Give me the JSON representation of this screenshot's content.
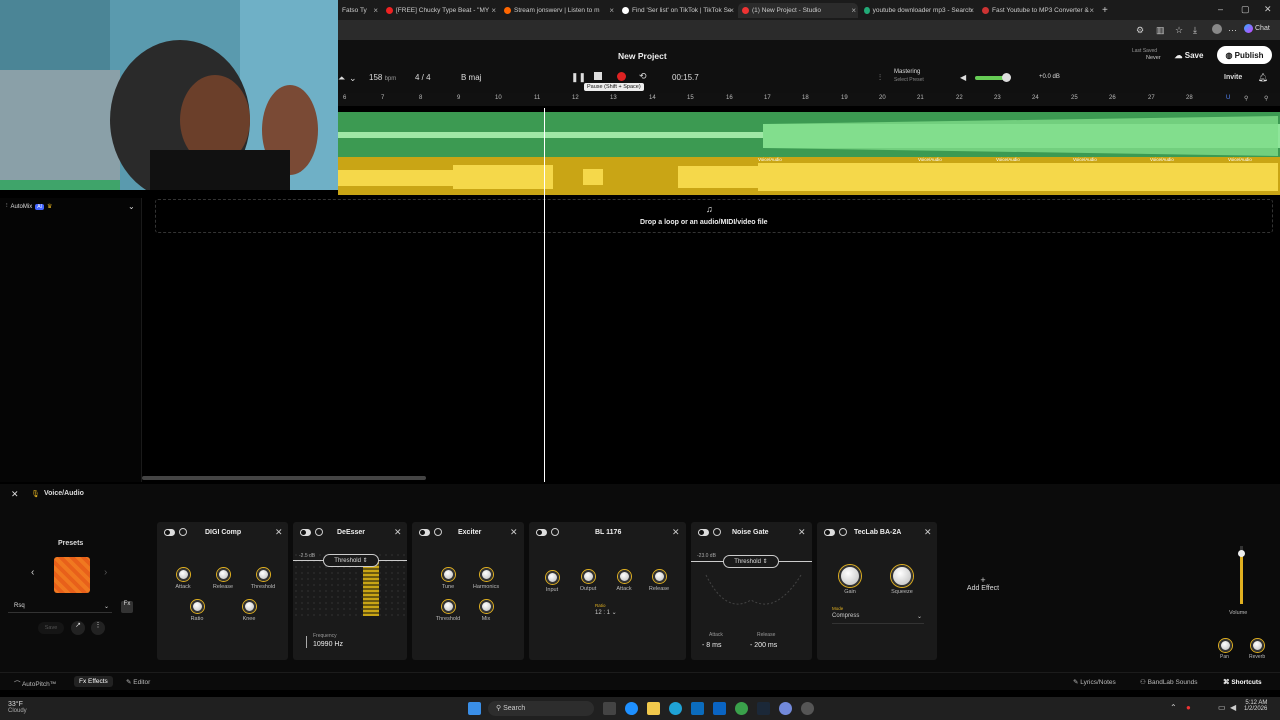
{
  "browser": {
    "tabs": [
      {
        "label": "Fatso Ty",
        "active": false
      },
      {
        "label": "[FREE] Chucky Type Beat - \"MY",
        "active": false
      },
      {
        "label": "Stream jonswerv | Listen to m",
        "active": false
      },
      {
        "label": "Find 'Ser list' on TikTok | TikTok Se",
        "active": false
      },
      {
        "label": "(1) New Project - Studio",
        "active": true
      },
      {
        "label": "youtube downloader mp3 - Search",
        "active": false
      },
      {
        "label": "Fast Youtube to MP3 Converter &",
        "active": false
      }
    ],
    "new_tab": "+",
    "chat_label": "Chat"
  },
  "header": {
    "project_title": "New Project",
    "bpm_value": "158",
    "bpm_unit": "bpm",
    "time_signature": "4 / 4",
    "key": "B maj",
    "time_display": "00:15.7",
    "tooltip": "Pause (Shift + Space)",
    "mastering_label": "Mastering",
    "mastering_sub": "Select Preset",
    "volume_db": "+0.0 dB",
    "last_saved_label": "Last Saved",
    "last_saved_value": "Never",
    "save_label": "Save",
    "publish_label": "Publish",
    "invite_label": "Invite"
  },
  "ruler": {
    "ticks": [
      "6",
      "7",
      "8",
      "9",
      "10",
      "11",
      "12",
      "13",
      "14",
      "15",
      "16",
      "17",
      "18",
      "19",
      "20",
      "21",
      "22",
      "23",
      "24",
      "25",
      "26",
      "27",
      "28"
    ]
  },
  "tracks": {
    "clip_label": "Voice/Audio",
    "drop_text": "Drop a loop or an audio/MIDI/video file",
    "automix_label": "AutoMix",
    "automix_badge": "AI"
  },
  "fx": {
    "track_name": "Voice/Audio",
    "presets_label": "Presets",
    "preset_name": "Rsq",
    "save_label": "Save",
    "add_effect_label": "Add Effect",
    "add_effect_plus": "+",
    "volume_label": "Volume",
    "pan_label": "Pan",
    "reverb_label": "Reverb",
    "plugins": {
      "digi_comp": {
        "title": "DIGI Comp",
        "knobs": [
          "Attack",
          "Release",
          "Threshold",
          "Ratio",
          "Knee"
        ]
      },
      "deesser": {
        "title": "DeEsser",
        "threshold": "Threshold",
        "db": "-2.5 dB",
        "freq_label": "Frequency",
        "freq_value": "10990 Hz"
      },
      "exciter": {
        "title": "Exciter",
        "knobs": [
          "Tune",
          "Harmonics",
          "Threshold",
          "Mix"
        ]
      },
      "bl1176": {
        "title": "BL 1176",
        "knobs": [
          "Input",
          "Output",
          "Attack",
          "Release"
        ],
        "ratio_label": "Ratio",
        "ratio_value": "12 : 1"
      },
      "noise_gate": {
        "title": "Noise Gate",
        "threshold": "Threshold",
        "db": "-23.0 dB",
        "attack_label": "Attack",
        "attack_value": "8 ms",
        "release_label": "Release",
        "release_value": "200 ms"
      },
      "teclab": {
        "title": "TecLab BA-2A",
        "knobs": [
          "Gain",
          "Squeeze"
        ],
        "mode_label": "Mode",
        "mode_value": "Compress"
      }
    }
  },
  "bottombar": {
    "autopitch": "AutoPitch™",
    "effects": "Effects",
    "editor": "Editor",
    "lyrics": "Lyrics/Notes",
    "sounds": "BandLab Sounds",
    "shortcuts": "Shortcuts",
    "fx_prefix": "Fx"
  },
  "taskbar": {
    "temp": "33°F",
    "weather": "Cloudy",
    "search": "Search",
    "time": "5:12 AM",
    "date": "1/2/2026"
  },
  "colors": {
    "green_track": "#3c9a52",
    "yellow_track": "#c9a515",
    "accent_yellow": "#e0b020"
  }
}
